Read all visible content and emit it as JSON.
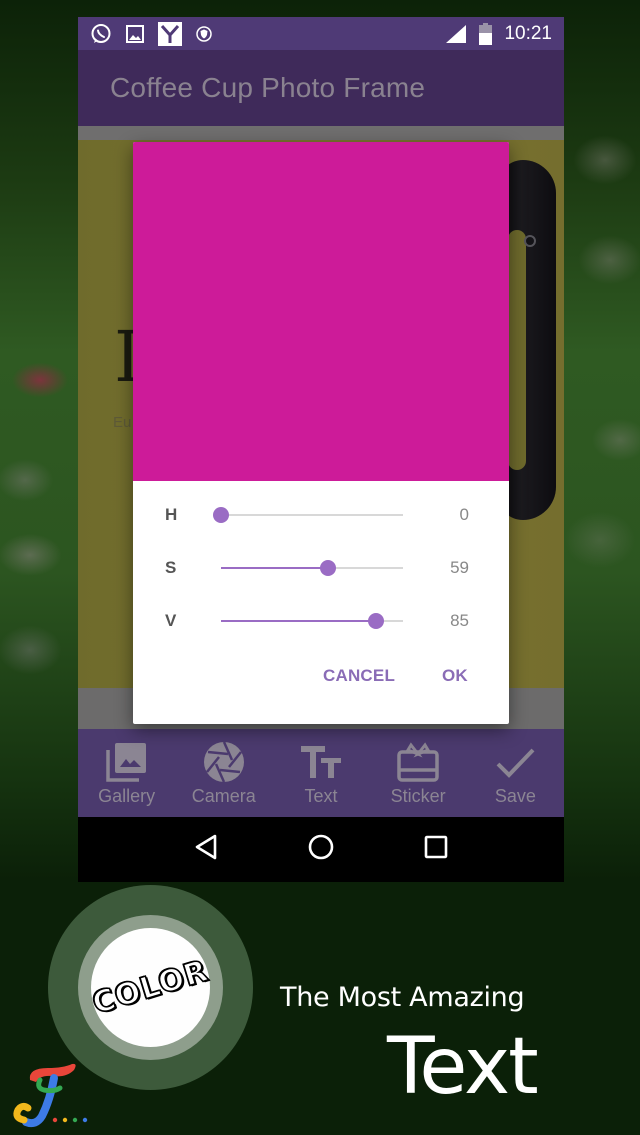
{
  "status_bar": {
    "notification_icons": [
      "whatsapp-icon",
      "image-icon",
      "yahoo-y-icon",
      "shield-icon"
    ],
    "signal_icon": "cell-signal-icon",
    "battery_icon": "battery-icon",
    "time": "10:21"
  },
  "app_bar": {
    "title": "Coffee Cup Photo Frame"
  },
  "photo": {
    "visible_letter": "I",
    "visible_subtext": "Eu"
  },
  "color_picker_dialog": {
    "preview_color": "#cd1b99",
    "sliders": [
      {
        "label": "H",
        "value": "0",
        "fraction": 0.0
      },
      {
        "label": "S",
        "value": "59",
        "fraction": 0.59
      },
      {
        "label": "V",
        "value": "85",
        "fraction": 0.85
      }
    ],
    "cancel_label": "CANCEL",
    "ok_label": "OK",
    "accent_color": "#9a6cc4"
  },
  "toolbar": {
    "items": [
      {
        "label": "Gallery",
        "icon": "gallery-icon"
      },
      {
        "label": "Camera",
        "icon": "camera-shutter-icon"
      },
      {
        "label": "Text",
        "icon": "text-size-icon"
      },
      {
        "label": "Sticker",
        "icon": "gift-sticker-icon"
      },
      {
        "label": "Save",
        "icon": "check-icon"
      }
    ]
  },
  "nav_bar": {
    "buttons": [
      "back-icon",
      "home-icon",
      "recents-icon"
    ]
  },
  "promo": {
    "badge_word": "COLOR",
    "tagline": "The Most Amazing",
    "headline": "Text"
  }
}
